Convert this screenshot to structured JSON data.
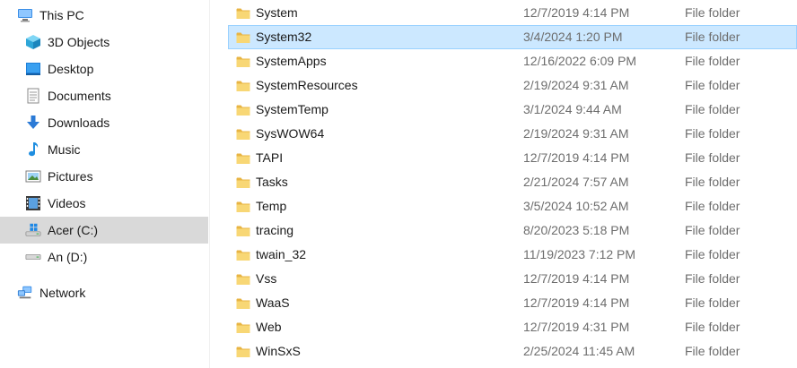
{
  "sidebar": {
    "items": [
      {
        "label": "This PC",
        "icon": "computer-icon",
        "level": 0,
        "selected": false
      },
      {
        "label": "3D Objects",
        "icon": "cube-icon",
        "level": 1,
        "selected": false
      },
      {
        "label": "Desktop",
        "icon": "desktop-icon",
        "level": 1,
        "selected": false
      },
      {
        "label": "Documents",
        "icon": "document-icon",
        "level": 1,
        "selected": false
      },
      {
        "label": "Downloads",
        "icon": "download-arrow-icon",
        "level": 1,
        "selected": false
      },
      {
        "label": "Music",
        "icon": "music-note-icon",
        "level": 1,
        "selected": false
      },
      {
        "label": "Pictures",
        "icon": "picture-icon",
        "level": 1,
        "selected": false
      },
      {
        "label": "Videos",
        "icon": "film-icon",
        "level": 1,
        "selected": false
      },
      {
        "label": "Acer (C:)",
        "icon": "windows-drive-icon",
        "level": 1,
        "selected": true
      },
      {
        "label": "An (D:)",
        "icon": "drive-icon",
        "level": 1,
        "selected": false
      },
      {
        "label": "Network",
        "icon": "network-icon",
        "level": 0,
        "selected": false
      }
    ]
  },
  "files": [
    {
      "name": "System",
      "date": "12/7/2019 4:14 PM",
      "type": "File folder",
      "selected": false
    },
    {
      "name": "System32",
      "date": "3/4/2024 1:20 PM",
      "type": "File folder",
      "selected": true
    },
    {
      "name": "SystemApps",
      "date": "12/16/2022 6:09 PM",
      "type": "File folder",
      "selected": false
    },
    {
      "name": "SystemResources",
      "date": "2/19/2024 9:31 AM",
      "type": "File folder",
      "selected": false
    },
    {
      "name": "SystemTemp",
      "date": "3/1/2024 9:44 AM",
      "type": "File folder",
      "selected": false
    },
    {
      "name": "SysWOW64",
      "date": "2/19/2024 9:31 AM",
      "type": "File folder",
      "selected": false
    },
    {
      "name": "TAPI",
      "date": "12/7/2019 4:14 PM",
      "type": "File folder",
      "selected": false
    },
    {
      "name": "Tasks",
      "date": "2/21/2024 7:57 AM",
      "type": "File folder",
      "selected": false
    },
    {
      "name": "Temp",
      "date": "3/5/2024 10:52 AM",
      "type": "File folder",
      "selected": false
    },
    {
      "name": "tracing",
      "date": "8/20/2023 5:18 PM",
      "type": "File folder",
      "selected": false
    },
    {
      "name": "twain_32",
      "date": "11/19/2023 7:12 PM",
      "type": "File folder",
      "selected": false
    },
    {
      "name": "Vss",
      "date": "12/7/2019 4:14 PM",
      "type": "File folder",
      "selected": false
    },
    {
      "name": "WaaS",
      "date": "12/7/2019 4:14 PM",
      "type": "File folder",
      "selected": false
    },
    {
      "name": "Web",
      "date": "12/7/2019 4:31 PM",
      "type": "File folder",
      "selected": false
    },
    {
      "name": "WinSxS",
      "date": "2/25/2024 11:45 AM",
      "type": "File folder",
      "selected": false
    }
  ],
  "colors": {
    "selection_bg": "#cce8ff",
    "selection_border": "#99d1ff",
    "nav_selected_bg": "#d9d9d9",
    "folder_yellow": "#f8d775",
    "secondary_text": "#6d6d6d"
  }
}
